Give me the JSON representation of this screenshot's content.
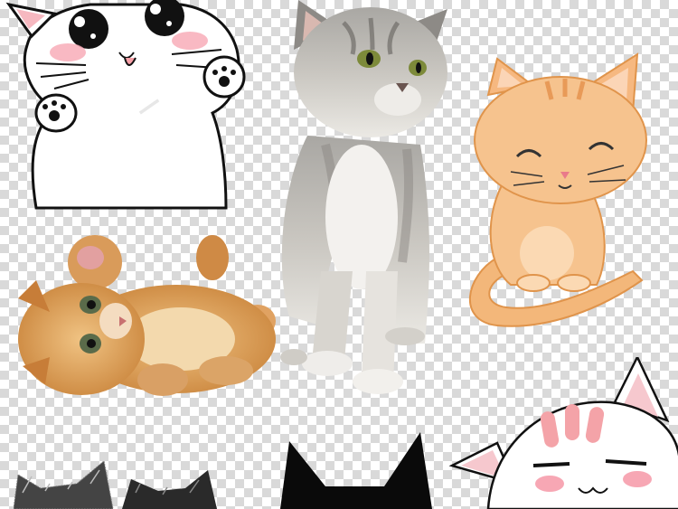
{
  "image": {
    "kind": "collage of cat images on transparency checkerboard",
    "background": "transparent-checkerboard",
    "checker_colors": [
      "#ffffff",
      "#d9d9d9"
    ],
    "items": [
      {
        "name": "cartoon-white-cat-waving",
        "style": "cartoon"
      },
      {
        "name": "grey-tabby-kitten-standing",
        "style": "photo"
      },
      {
        "name": "orange-cartoon-cat-sitting",
        "style": "watercolor cartoon"
      },
      {
        "name": "orange-kitten-lying-on-back",
        "style": "photo"
      },
      {
        "name": "fluffy-black-kitten-head-top",
        "style": "photo"
      },
      {
        "name": "black-cat-silhouette-head-top",
        "style": "silhouette"
      },
      {
        "name": "cartoon-white-cat-peeking",
        "style": "cartoon"
      }
    ]
  }
}
